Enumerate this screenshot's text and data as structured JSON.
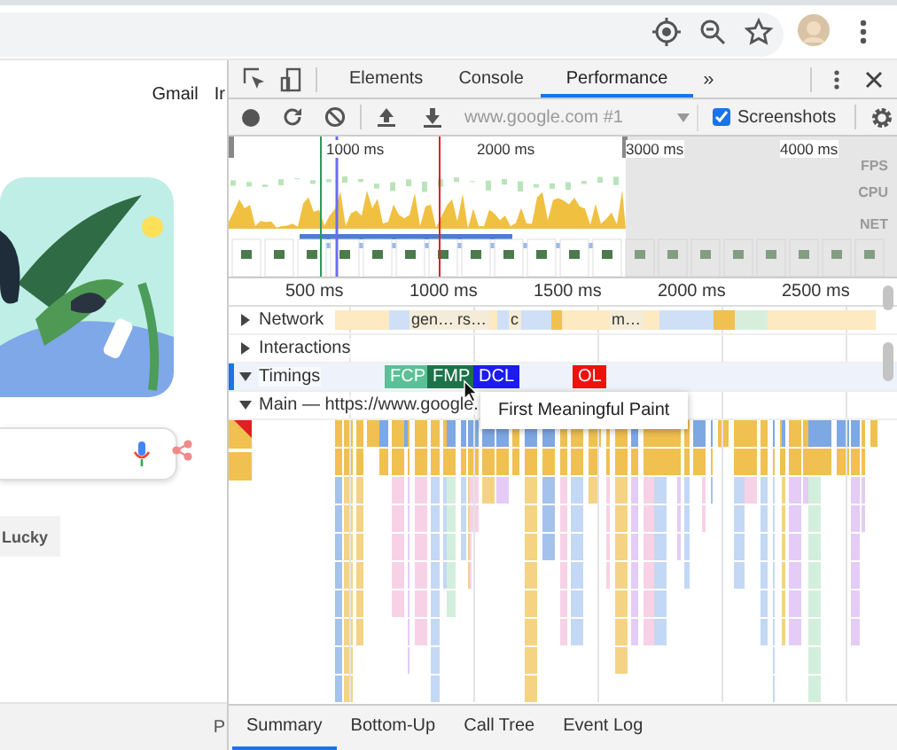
{
  "page": {
    "header_links": [
      "Gmail",
      "Ir"
    ],
    "lucky_button": "Lucky",
    "footer_text": "P"
  },
  "devtools": {
    "tabs": [
      {
        "label": "Elements",
        "selected": false
      },
      {
        "label": "Console",
        "selected": false
      },
      {
        "label": "Performance",
        "selected": true
      }
    ],
    "more_tabs": "»",
    "toolbar": {
      "recording_select": "www.google.com #1",
      "screenshots": {
        "label": "Screenshots",
        "checked": true
      }
    },
    "overview": {
      "ruler": [
        "1000 ms",
        "2000 ms",
        "3000 ms",
        "4000 ms"
      ],
      "lanes": [
        "FPS",
        "CPU",
        "NET"
      ]
    },
    "ruler": [
      "500 ms",
      "1000 ms",
      "1500 ms",
      "2000 ms",
      "2500 ms"
    ],
    "tracks": [
      {
        "label": "Network",
        "expanded": false,
        "selected": false,
        "items": [
          "gen…",
          "rs…",
          "c",
          "m…"
        ]
      },
      {
        "label": "Interactions",
        "expanded": false,
        "selected": false
      },
      {
        "label": "Timings",
        "expanded": true,
        "selected": true,
        "markers": [
          {
            "label": "FCP",
            "color": "#5cbf98"
          },
          {
            "label": "FMP",
            "color": "#1d7349"
          },
          {
            "label": "DCL",
            "color": "#1c1cf0"
          },
          {
            "label": "OL",
            "color": "#f01010"
          }
        ]
      },
      {
        "label": "Main — https://www.google.",
        "expanded": true,
        "selected": false
      }
    ],
    "tooltip": "First Meaningful Paint",
    "bottom_tabs": [
      {
        "label": "Summary",
        "selected": true
      },
      {
        "label": "Bottom-Up",
        "selected": false
      },
      {
        "label": "Call Tree",
        "selected": false
      },
      {
        "label": "Event Log",
        "selected": false
      }
    ]
  }
}
